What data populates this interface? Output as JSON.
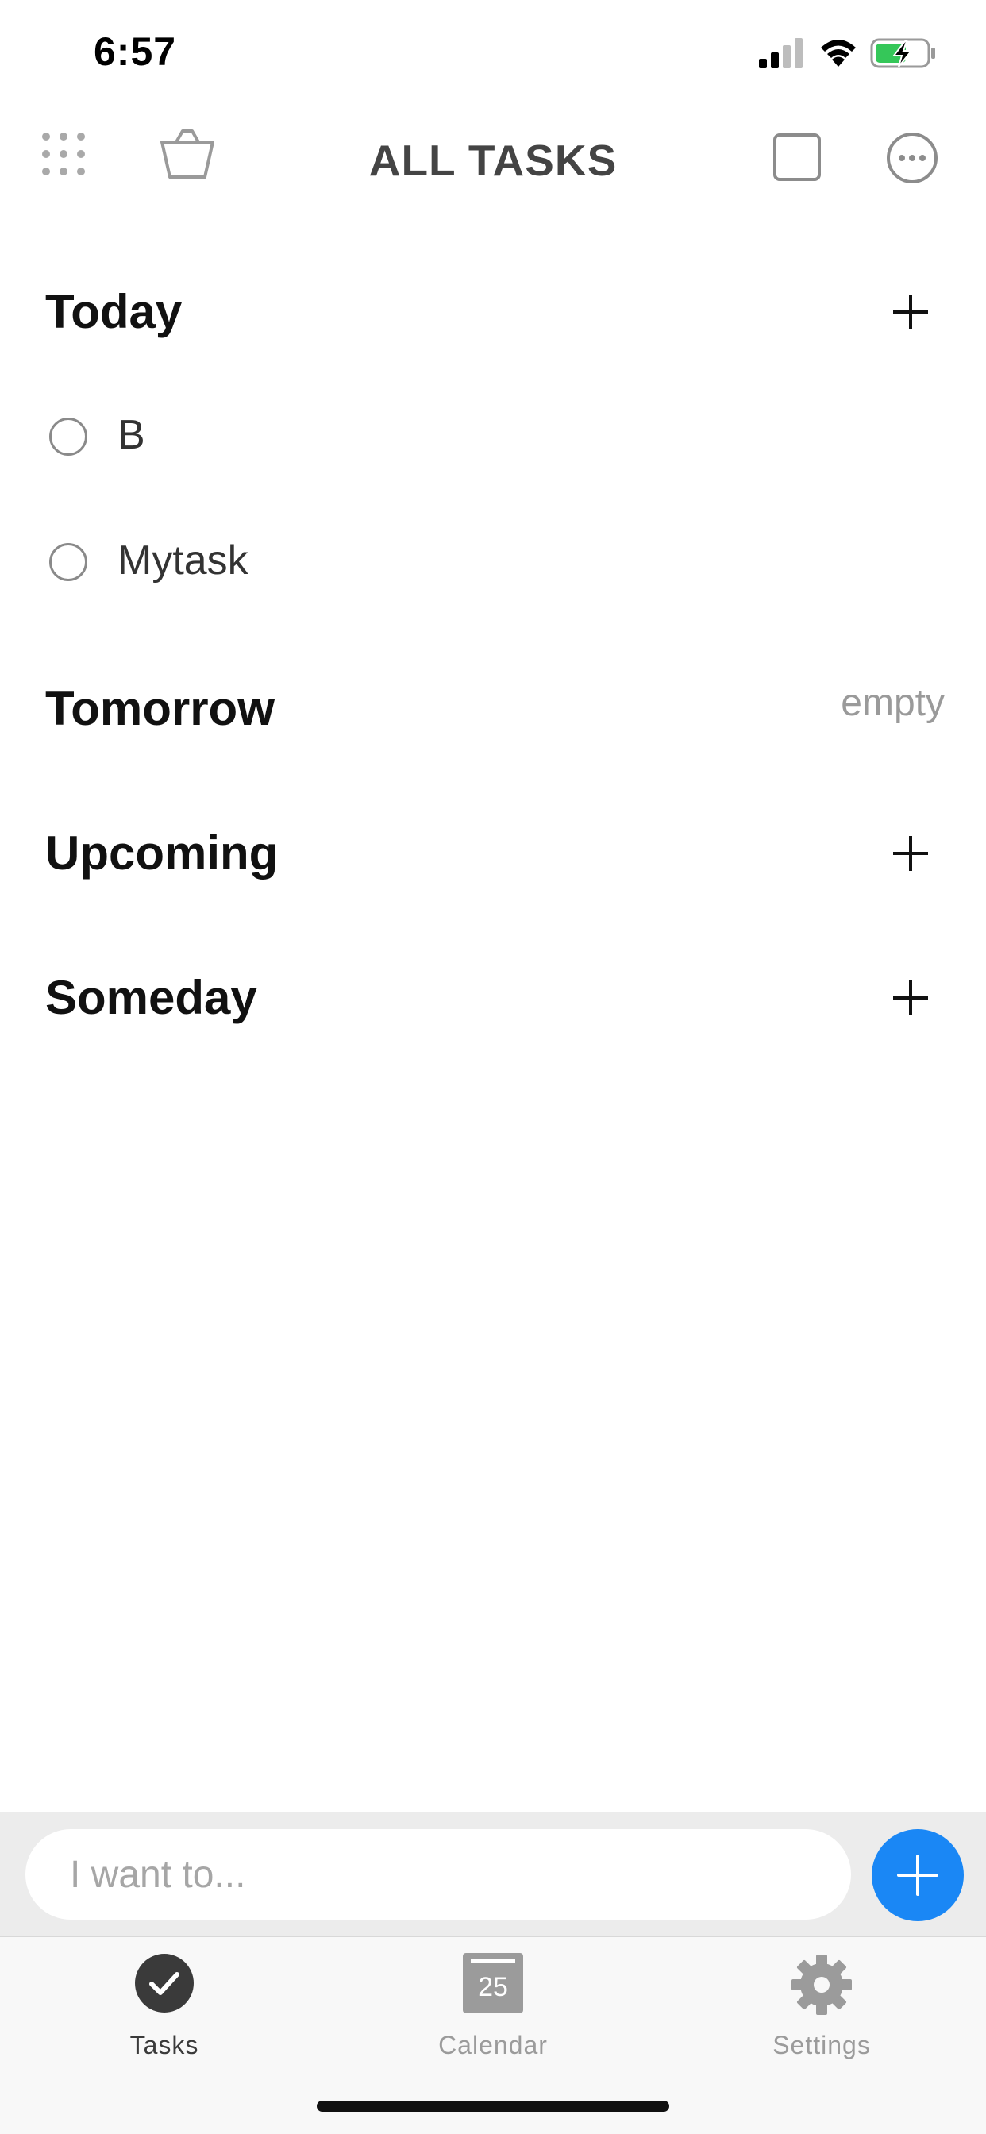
{
  "status_bar": {
    "time": "6:57"
  },
  "nav": {
    "title": "ALL TASKS",
    "icons": [
      "apps-grid-icon",
      "basket-icon",
      "square-icon",
      "more-icon"
    ]
  },
  "sections": {
    "today": {
      "title": "Today",
      "tasks": [
        "B",
        "Mytask"
      ]
    },
    "tomorrow": {
      "title": "Tomorrow",
      "empty_label": "empty"
    },
    "upcoming": {
      "title": "Upcoming"
    },
    "someday": {
      "title": "Someday"
    }
  },
  "input": {
    "placeholder": "I want to..."
  },
  "tabs": [
    {
      "label": "Tasks",
      "icon": "checkmark-circle-icon",
      "active": true
    },
    {
      "label": "Calendar",
      "icon": "calendar-icon",
      "day": "25",
      "active": false
    },
    {
      "label": "Settings",
      "icon": "gear-icon",
      "active": false
    }
  ],
  "colors": {
    "accent": "#1a87f5",
    "active_tab": "#3a3a3a",
    "inactive_tab": "#9b9b9b",
    "battery": "#35c759"
  }
}
